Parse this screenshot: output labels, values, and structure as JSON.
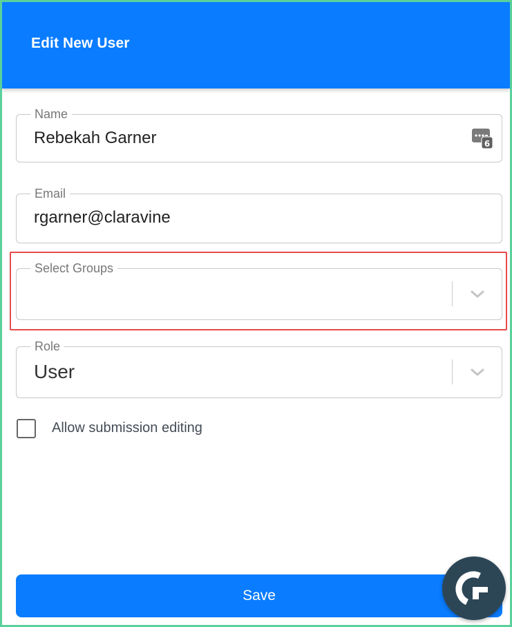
{
  "header": {
    "title": "Edit New User"
  },
  "form": {
    "name": {
      "label": "Name",
      "value": "Rebekah Garner",
      "password_manager_count": "6"
    },
    "email": {
      "label": "Email",
      "value": "rgarner@claravine"
    },
    "groups": {
      "label": "Select Groups",
      "value": ""
    },
    "role": {
      "label": "Role",
      "value": "User"
    },
    "allow_editing": {
      "label": "Allow submission editing",
      "checked": false
    }
  },
  "actions": {
    "save_label": "Save"
  },
  "icons": {
    "password_manager": "password-manager-icon",
    "chevron": "chevron-down-icon",
    "chat": "chat-launcher-icon"
  },
  "colors": {
    "primary": "#0a7cff",
    "highlight": "#e64a4a",
    "frame": "#5ad19a",
    "chat_bg": "#2c4656"
  }
}
